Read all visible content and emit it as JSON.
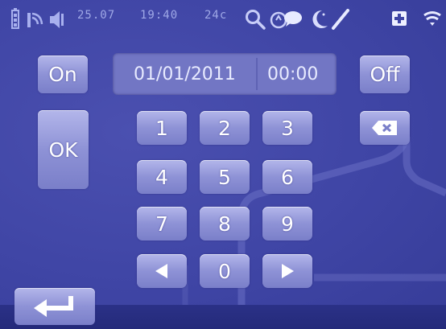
{
  "status_bar": {
    "date": "25.07",
    "time": "19:40",
    "temperature": "24c"
  },
  "datetime": {
    "date_value": "01/01/2011",
    "time_value": "00:00"
  },
  "buttons": {
    "on_label": "On",
    "off_label": "Off",
    "ok_label": "OK"
  },
  "keypad": {
    "keys": [
      "1",
      "2",
      "3",
      "4",
      "5",
      "6",
      "7",
      "8",
      "9",
      "0"
    ]
  },
  "icons": {
    "battery": "battery-icon",
    "signal": "signal-icon",
    "speaker": "speaker-icon",
    "search": "search-icon",
    "thermostat": "thermostat-icon",
    "night": "moon-icon",
    "edit": "pencil-icon",
    "plus": "plus-icon",
    "wifi": "wifi-icon",
    "backspace": "backspace-icon",
    "left_arrow": "left-arrow-icon",
    "right_arrow": "right-arrow-icon",
    "enter": "enter-icon"
  },
  "colors": {
    "background": "#4045a7",
    "button": "#9a9ee0",
    "status_text": "#9fa8e6"
  }
}
